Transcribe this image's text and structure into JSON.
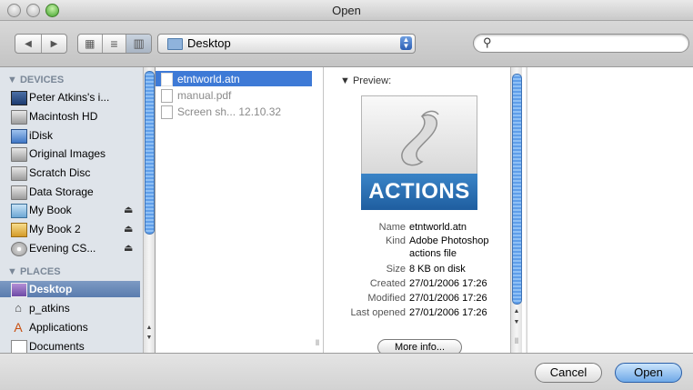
{
  "window": {
    "title": "Open"
  },
  "toolbar": {
    "back_glyph": "◀",
    "forward_glyph": "▶",
    "view_icon_glyph": "▦",
    "view_list_glyph": "≡",
    "view_column_glyph": "▥",
    "location": "Desktop",
    "location_arrows": "▲▼",
    "search_glyph": "🔍",
    "search_value": "",
    "search_placeholder": ""
  },
  "sidebar": {
    "devices_header": "▼ DEVICES",
    "devices": [
      {
        "label": "Peter Atkins's i...",
        "icon": "computer-icon"
      },
      {
        "label": "Macintosh HD",
        "icon": "hard-drive-icon"
      },
      {
        "label": "iDisk",
        "icon": "idisk-icon"
      },
      {
        "label": "Original Images",
        "icon": "hard-drive-icon"
      },
      {
        "label": "Scratch Disc",
        "icon": "hard-drive-icon"
      },
      {
        "label": "Data Storage",
        "icon": "hard-drive-icon"
      },
      {
        "label": "My Book",
        "icon": "external-drive-icon",
        "eject": "⏏"
      },
      {
        "label": "My Book 2",
        "icon": "external-drive-icon",
        "eject": "⏏"
      },
      {
        "label": "Evening CS...",
        "icon": "disc-icon",
        "eject": "⏏"
      }
    ],
    "places_header": "▼ PLACES",
    "places": [
      {
        "label": "Desktop",
        "icon": "desktop-icon",
        "selected": true
      },
      {
        "label": "p_atkins",
        "icon": "home-icon"
      },
      {
        "label": "Applications",
        "icon": "applications-icon"
      },
      {
        "label": "Documents",
        "icon": "documents-icon"
      }
    ]
  },
  "files": [
    {
      "name": "etntworld.atn",
      "selected": true
    },
    {
      "name": "manual.pdf",
      "selected": false
    },
    {
      "name": "Screen sh... 12.10.32",
      "selected": false
    }
  ],
  "preview": {
    "label": "▼ Preview:",
    "icon_text": "ACTIONS",
    "name_key": "Name",
    "name_val": "etntworld.atn",
    "kind_key": "Kind",
    "kind_val_1": "Adobe Photoshop",
    "kind_val_2": "actions file",
    "size_key": "Size",
    "size_val": "8 KB on disk",
    "created_key": "Created",
    "created_val": "27/01/2006 17:26",
    "modified_key": "Modified",
    "modified_val": "27/01/2006 17:26",
    "opened_key": "Last opened",
    "opened_val": "27/01/2006 17:26",
    "more_info": "More info..."
  },
  "buttons": {
    "cancel": "Cancel",
    "open": "Open"
  },
  "colors": {
    "selection": "#3e7ad6",
    "sidebar_bg": "#dfe4ea",
    "actions_band": "#2a6fb3"
  }
}
